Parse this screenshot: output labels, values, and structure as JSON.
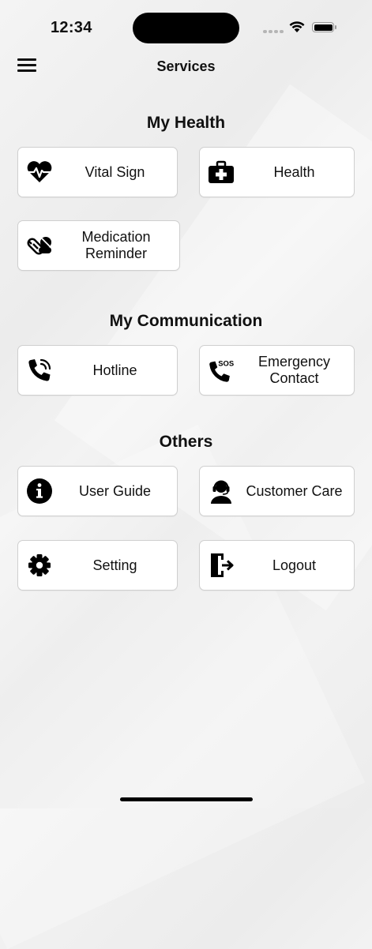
{
  "status": {
    "time": "12:34"
  },
  "header": {
    "title": "Services",
    "menu_icon": "hamburger-menu-icon"
  },
  "sections": {
    "health": {
      "title": "My Health",
      "items": [
        {
          "label": "Vital Sign",
          "icon": "heartbeat-icon"
        },
        {
          "label": "Health",
          "icon": "first-aid-kit-icon"
        },
        {
          "label": "Medication Reminder",
          "icon": "pills-icon"
        }
      ]
    },
    "communication": {
      "title": "My Communication",
      "items": [
        {
          "label": "Hotline",
          "icon": "phone-ringing-icon"
        },
        {
          "label": "Emergency Contact",
          "icon": "phone-sos-icon"
        }
      ]
    },
    "others": {
      "title": "Others",
      "items": [
        {
          "label": "User Guide",
          "icon": "info-icon"
        },
        {
          "label": "Customer Care",
          "icon": "headset-agent-icon"
        },
        {
          "label": "Setting",
          "icon": "gear-icon"
        },
        {
          "label": "Logout",
          "icon": "logout-door-icon"
        }
      ]
    }
  }
}
